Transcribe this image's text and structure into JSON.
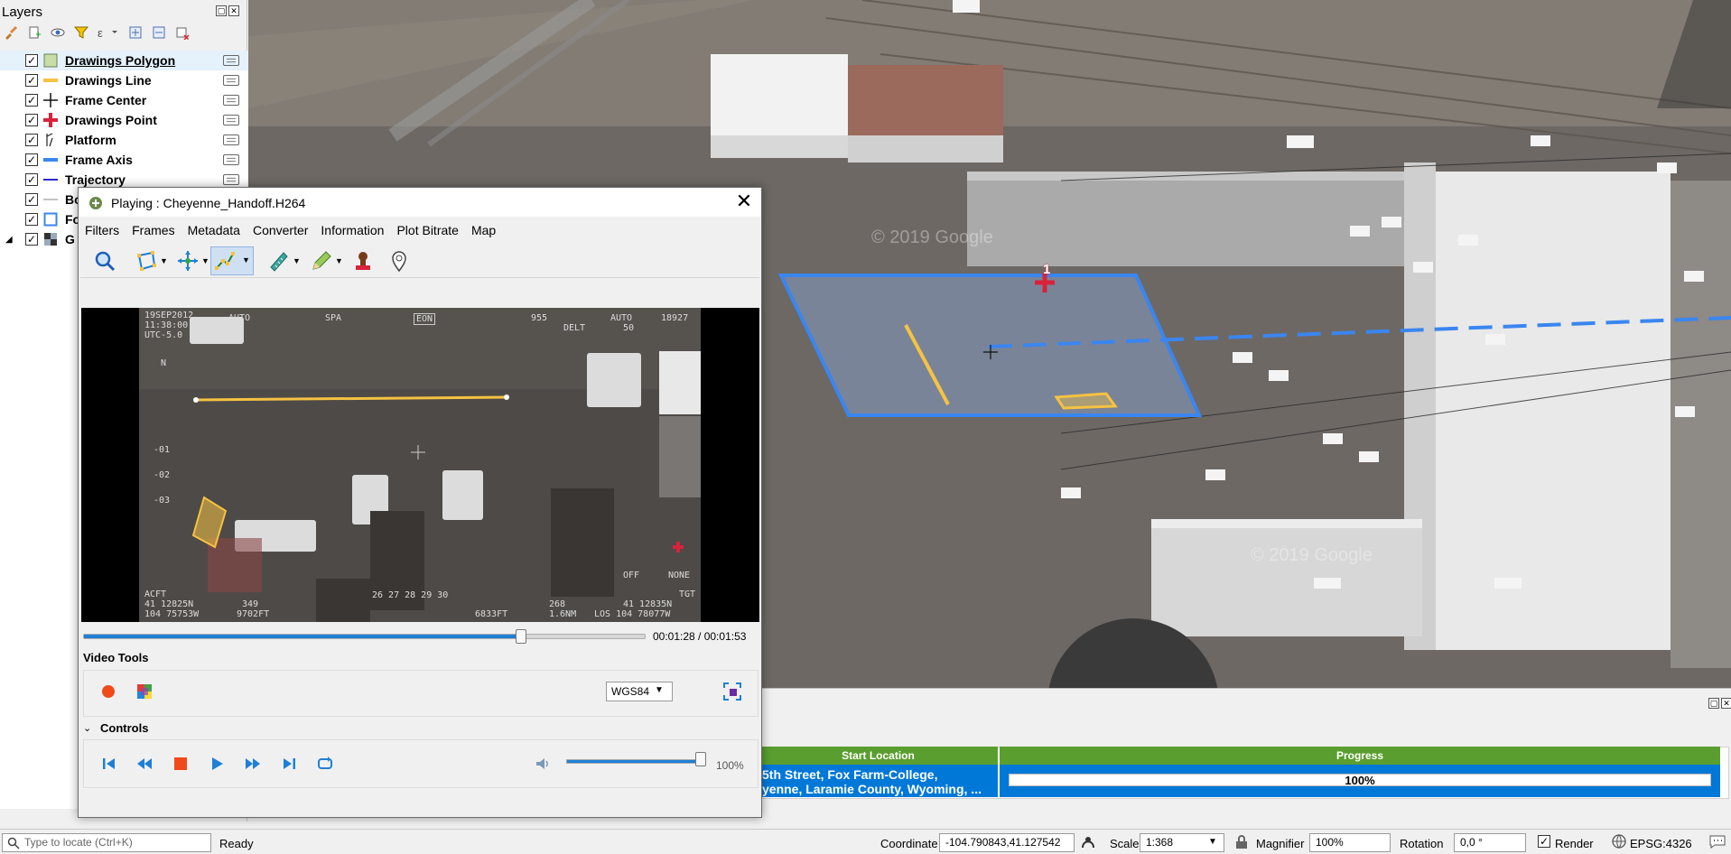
{
  "layers_panel": {
    "title": "Layers",
    "layers": [
      {
        "name": "Drawings Polygon",
        "checked": true,
        "symbol": "polygon-fill-icon",
        "underline": true
      },
      {
        "name": "Drawings Line",
        "checked": true,
        "symbol": "yellow-line-icon"
      },
      {
        "name": "Frame Center",
        "checked": true,
        "symbol": "crosshair-icon"
      },
      {
        "name": "Drawings Point",
        "checked": true,
        "symbol": "red-cross-icon"
      },
      {
        "name": "Platform",
        "checked": true,
        "symbol": "platform-icon"
      },
      {
        "name": "Frame Axis",
        "checked": true,
        "symbol": "blue-line-icon"
      },
      {
        "name": "Trajectory",
        "checked": true,
        "symbol": "dark-blue-line-icon"
      },
      {
        "name": "Bo",
        "checked": true,
        "symbol": "thin-line-icon"
      },
      {
        "name": "Fo",
        "checked": true,
        "symbol": "outline-square-icon"
      },
      {
        "name": "G",
        "checked": true,
        "symbol": "raster-icon"
      }
    ]
  },
  "player": {
    "title": "Playing : Cheyenne_Handoff.H264",
    "menu": [
      "Filters",
      "Frames",
      "Metadata",
      "Converter",
      "Information",
      "Plot Bitrate",
      "Map"
    ],
    "time": "00:01:28 / 00:01:53",
    "progress": 0.779,
    "video_tools_label": "Video Tools",
    "crs": "WGS84",
    "controls_label": "Controls",
    "volume": "100%",
    "volume_level": 1.0,
    "overlay": {
      "top_left": "19SEP2012",
      "time": "11:38:00",
      "utc": "UTC-5.0",
      "auto": "AUTO",
      "spa": "SPA",
      "eon": "EON",
      "n955": "955",
      "auto2": "AUTO",
      "n18927": "18927",
      "delt": "DELT",
      "n50": "50",
      "north": "N",
      "tick1": "-01",
      "tick2": "-02",
      "tick3": "-03",
      "acft": "ACFT",
      "coord1": "41 12825N",
      "coord2": "104 75753W",
      "n349": "349",
      "n9702": "9702FT",
      "mid": "26 27 28 29 30",
      "n6833": "6833FT",
      "n268": "268",
      "n16": "1.6NM",
      "los": "LOS 104 78077W",
      "coord3": "41 12835N",
      "off": "OFF",
      "none": "NONE",
      "tgt": "TGT"
    }
  },
  "map": {
    "marker_label": "1",
    "watermark1": "© 2019 Google",
    "watermark2": "© 2019 Google"
  },
  "task_table": {
    "headers": [
      "Start Location",
      "Progress"
    ],
    "location_line1": "5th Street, Fox Farm-College,",
    "location_line2": "yenne, Laramie County, Wyoming, ...",
    "progress_text": "100%",
    "progress_value": 1.0
  },
  "statusbar": {
    "locate_placeholder": "Type to locate (Ctrl+K)",
    "ready": "Ready",
    "coordinate_label": "Coordinate",
    "coordinate_value": "-104.790843,41.127542",
    "scale_label": "Scale",
    "scale_value": "1:368",
    "magnifier_label": "Magnifier",
    "magnifier_value": "100%",
    "rotation_label": "Rotation",
    "rotation_value": "0,0 °",
    "render_label": "Render",
    "crs": "EPSG:4326"
  },
  "colors": {
    "accent_blue": "#1f7fd6",
    "drawing_yellow": "#f5c242",
    "drawing_red": "#d9223b",
    "footprint_blue": "#3a86f0",
    "table_green": "#5a9e2f",
    "table_row_blue": "#0078d7"
  }
}
